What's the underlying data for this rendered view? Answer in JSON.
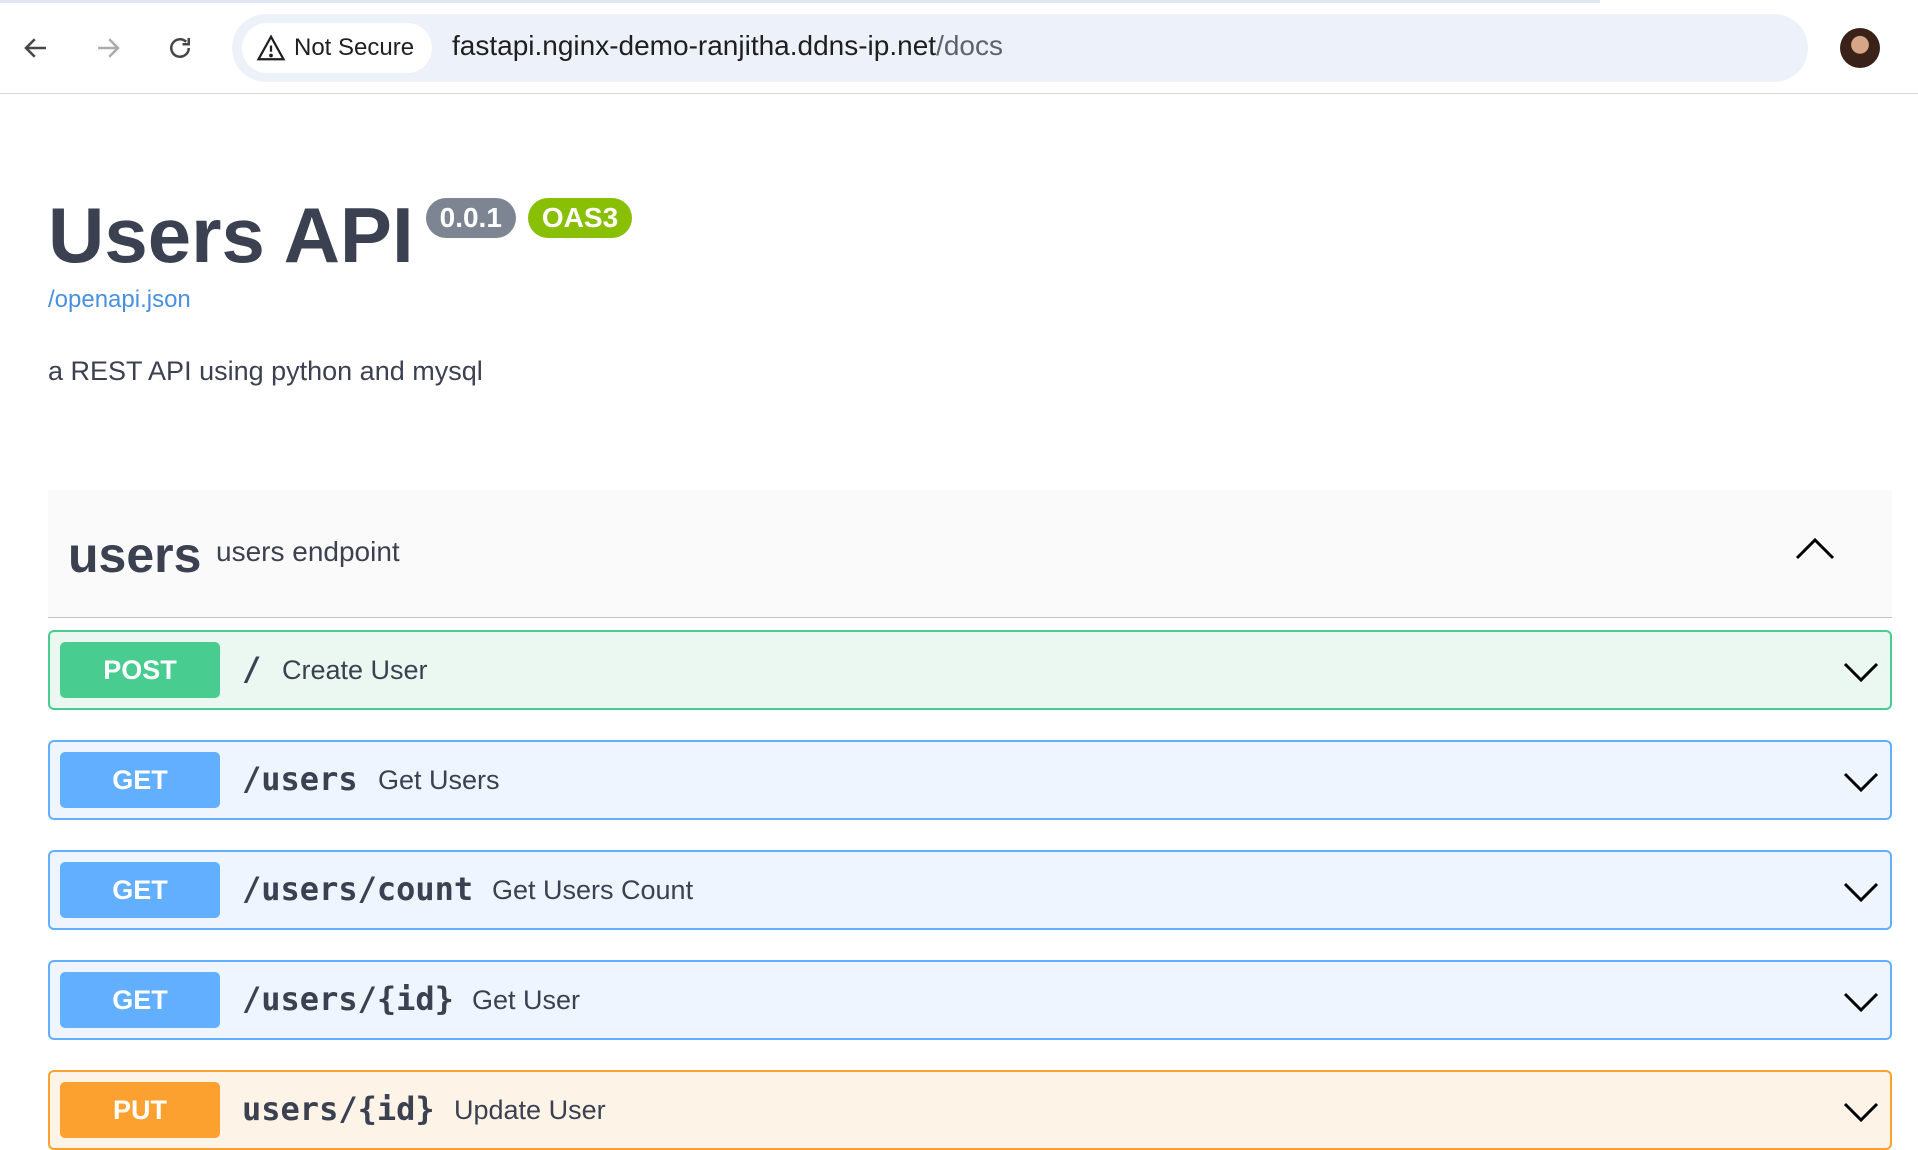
{
  "browser": {
    "security_label": "Not Secure",
    "url_host": "fastapi.nginx-demo-ranjitha.ddns-ip.net",
    "url_path": "/docs",
    "icons": [
      "back-arrow-icon",
      "forward-arrow-icon",
      "reload-icon",
      "warning-icon",
      "star-icon",
      "avatar"
    ]
  },
  "api": {
    "title": "Users API",
    "version": "0.0.1",
    "spec_badge": "OAS3",
    "spec_link": "/openapi.json",
    "description": "a REST API using python and mysql"
  },
  "tag": {
    "name": "users",
    "description": "users endpoint",
    "expanded": true
  },
  "operations": [
    {
      "method": "POST",
      "path": "/",
      "summary": "Create User"
    },
    {
      "method": "GET",
      "path": "/users",
      "summary": "Get Users"
    },
    {
      "method": "GET",
      "path": "/users/count",
      "summary": "Get Users Count"
    },
    {
      "method": "GET",
      "path": "/users/{id}",
      "summary": "Get User"
    },
    {
      "method": "PUT",
      "path": "users/{id}",
      "summary": "Update User"
    }
  ],
  "colors": {
    "post": "#49cc90",
    "get": "#61affe",
    "put": "#fca130",
    "version_badge": "#7d8492",
    "oas_badge": "#89bf04",
    "link": "#4990e2"
  }
}
